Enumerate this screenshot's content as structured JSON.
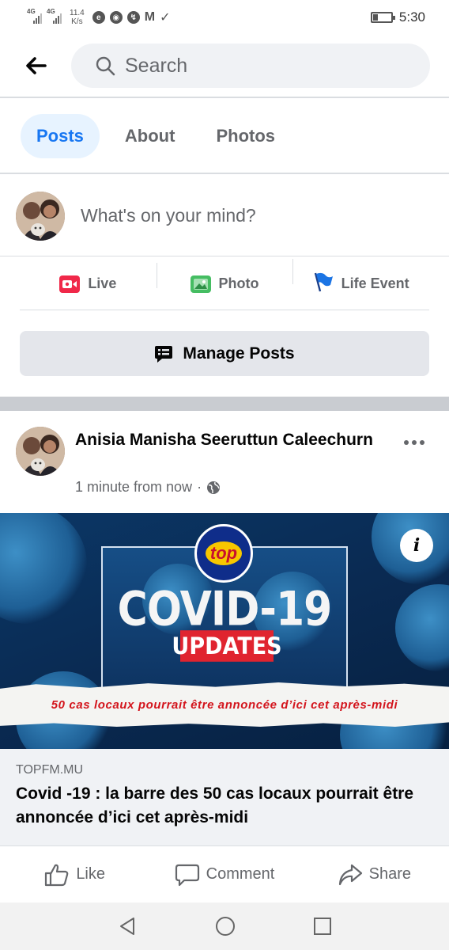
{
  "status_bar": {
    "signal1_tag": "4G",
    "signal2_tag": "4G",
    "net_speed_value": "11.4",
    "net_speed_unit": "K/s",
    "time": "5:30",
    "notification_icons": [
      "browser-icon",
      "chrome-icon",
      "messenger-icon",
      "gmail-icon",
      "check-icon"
    ],
    "battery_level": 0.2
  },
  "header": {
    "search_placeholder": "Search"
  },
  "tabs": [
    {
      "label": "Posts",
      "active": true
    },
    {
      "label": "About",
      "active": false
    },
    {
      "label": "Photos",
      "active": false
    }
  ],
  "composer": {
    "placeholder": "What's on your mind?"
  },
  "composer_actions": [
    {
      "label": "Live",
      "icon": "live-video-icon",
      "color": "#f02849"
    },
    {
      "label": "Photo",
      "icon": "photo-icon",
      "color": "#45bd62"
    },
    {
      "label": "Life Event",
      "icon": "flag-icon",
      "color": "#1b74e4"
    }
  ],
  "manage_posts": {
    "label": "Manage Posts",
    "icon": "manage-posts-icon"
  },
  "post": {
    "author": "Anisia Manisha Seeruttun Caleechurn",
    "timestamp": "1 minute from now",
    "privacy_icon": "globe-icon",
    "banner": {
      "logo_text": "top",
      "headline": "COVID-19",
      "subheadline": "UPDATES",
      "strip_text": "50 cas locaux pourrait être annoncée d’ici cet après-midi",
      "info_icon": "info-icon"
    },
    "link": {
      "domain": "TOPFM.MU",
      "title": "Covid -19 : la barre des 50 cas locaux pourrait être annoncée d’ici cet après-midi"
    },
    "reactions": [
      {
        "label": "Like",
        "icon": "like-icon"
      },
      {
        "label": "Comment",
        "icon": "comment-icon"
      },
      {
        "label": "Share",
        "icon": "share-icon"
      }
    ]
  },
  "colors": {
    "accent": "#1877f2",
    "tab_active_bg": "#e7f3ff",
    "secondary_text": "#65676b",
    "divider": "#c9ccd1"
  }
}
